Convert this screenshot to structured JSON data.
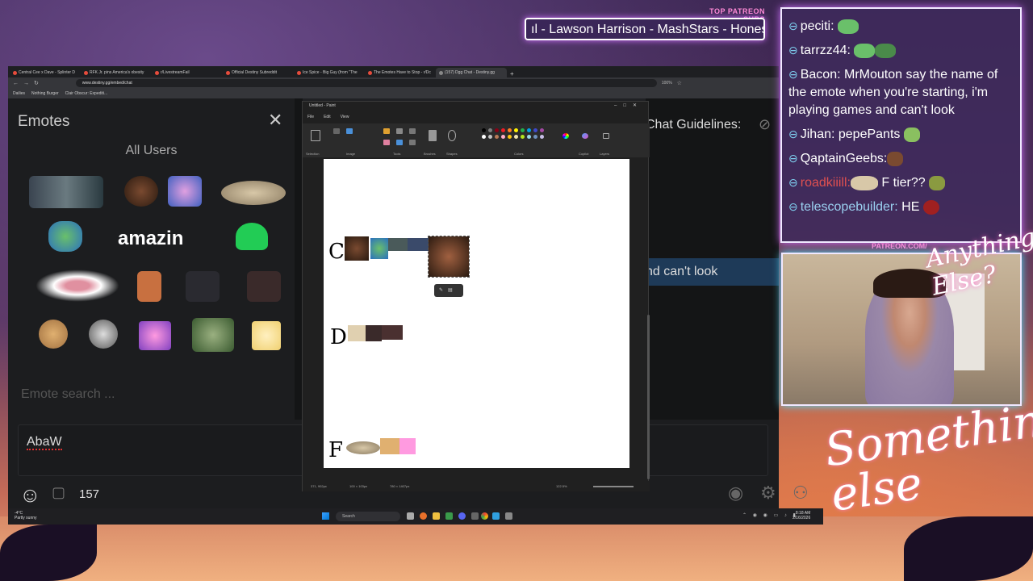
{
  "stream": {
    "patreon_label": "TOP PATREON SUBS",
    "patreon_ticker": "ıl - Lawson Harrison - MashStars - Honest",
    "overlay_text_top": "Anything Else?",
    "overlay_text_bottom": "Something else",
    "patreon_cam_label": "PATREON.COM/"
  },
  "browser": {
    "tabs": [
      {
        "label": "Central Cee x Dave - Splinter D"
      },
      {
        "label": "RFK Jr. pins America's obesity"
      },
      {
        "label": "r/LivestreamFail"
      },
      {
        "label": "Official Destiny Subreddit"
      },
      {
        "label": "Ice Spice - Big Guy (from \"The"
      },
      {
        "label": "The Emotes Have to Stop - r/Dc"
      },
      {
        "label": "(157) Dgg Chat - Destiny.gg",
        "active": true
      }
    ],
    "new_tab": "+",
    "url": "www.destiny.gg/embed/chat",
    "zoom": "100%",
    "bookmarks": [
      "Dailies",
      "Nothing Burger",
      "Clair Obscur: Expediti..."
    ]
  },
  "emotes_panel": {
    "title": "Emotes",
    "close": "✕",
    "section": "All Users",
    "amazon": "amazin",
    "search_placeholder": "Emote search ..."
  },
  "dgg": {
    "guidelines": "Chat Guidelines:",
    "banner_text": "nd can't look",
    "input_value": "AbaW",
    "user_count": "157"
  },
  "paint": {
    "title": "Untitled - Paint",
    "menu": [
      "File",
      "Edit",
      "View"
    ],
    "ribbon_groups": [
      "Selection",
      "Image",
      "Tools",
      "Brushes",
      "Shapes",
      "Colors",
      "Copilot",
      "Layers"
    ],
    "tiers": [
      "C",
      "D",
      "F"
    ],
    "status_pos": "371, 902px",
    "status_sel": "100 × 103px",
    "status_size": "780 × 1407px",
    "status_zoom": "122.5%",
    "colors": [
      "#000000",
      "#7f7f7f",
      "#880015",
      "#ed1c24",
      "#ff7f27",
      "#fff200",
      "#22b14c",
      "#00a2e8",
      "#3f48cc",
      "#a349a4",
      "#ffffff",
      "#c3c3c3",
      "#b97a57",
      "#ffaec9",
      "#ffc90e",
      "#efe4b0",
      "#b5e61d",
      "#99d9ea",
      "#7092be",
      "#c8bfe7"
    ]
  },
  "taskbar": {
    "weather_temp": "-4°C",
    "weather_desc": "Partly sunny",
    "search": "Search",
    "time": "8:18 AM",
    "date": "2/16/2026"
  },
  "chat_overlay": {
    "messages": [
      {
        "user": "peciti:",
        "text": ""
      },
      {
        "user": "tarrzz44:",
        "text": ""
      },
      {
        "user": "Bacon:",
        "text": " MrMouton  say the name of the emote when you're starting, i'm playing games and can't look"
      },
      {
        "user": "Jihan:",
        "text": " pepePants "
      },
      {
        "user": "QaptainGeebs:",
        "text": ""
      },
      {
        "user": "roadkiiill:",
        "text": " F tier?? "
      },
      {
        "user": "telescopebuilder:",
        "text": " HE "
      }
    ]
  }
}
